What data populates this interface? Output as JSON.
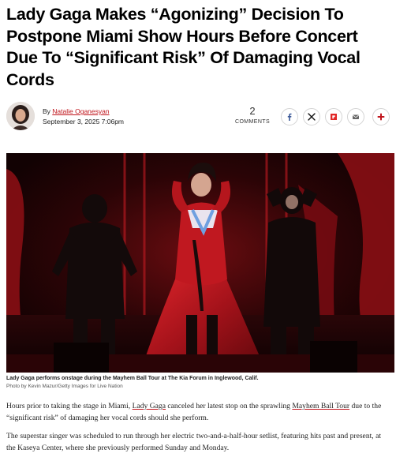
{
  "article": {
    "headline": "Lady Gaga Makes “Agonizing” Decision To Postpone Miami Show Hours Before Concert Due To “Significant Risk” Of Damaging Vocal Cords",
    "byline_prefix": "By",
    "author": "Natalie Oganesyan",
    "date": "September 3, 2025 7:06pm",
    "comments_count": "2",
    "comments_label": "COMMENTS",
    "image_caption": "Lady Gaga performs onstage during the Mayhem Ball Tour at The Kia Forum in Inglewood, Calif.",
    "image_credit": "Photo by Kevin Mazur/Getty Images for Live Nation",
    "para1_a": "Hours prior to taking the stage in Miami,",
    "para1_link1": "Lady Gaga",
    "para1_b": "canceled her latest stop on the sprawling",
    "para1_link2": "Mayhem Ball Tour",
    "para1_c": "due to the “significant risk” of damaging her vocal cords should she perform.",
    "para2": "The superstar singer was scheduled to run through her electric two-and-a-half-hour setlist, featuring hits past and present, at the Kaseya Center, where she previously performed Sunday and Monday."
  },
  "share": {
    "icons": [
      "facebook-icon",
      "x-icon",
      "flipboard-icon",
      "email-icon",
      "more-icon"
    ]
  },
  "colors": {
    "accent": "#c0141b",
    "stage_red": "#b0141a"
  }
}
